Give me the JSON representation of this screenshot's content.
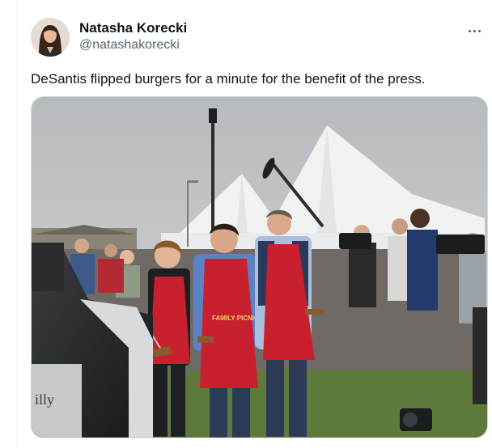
{
  "tweet": {
    "author": {
      "display_name": "Natasha Korecki",
      "handle": "@natashakorecki"
    },
    "text": "DeSantis flipped burgers for a minute for the benefit of the press.",
    "more_icon": "more-horizontal-icon",
    "media": {
      "apron_text_1": "FAMILY PICNIC",
      "grill_text": "illy"
    }
  },
  "colors": {
    "text_primary": "#0f1419",
    "text_secondary": "#536471",
    "border": "#cfd9de",
    "apron_red": "#c8202f"
  }
}
